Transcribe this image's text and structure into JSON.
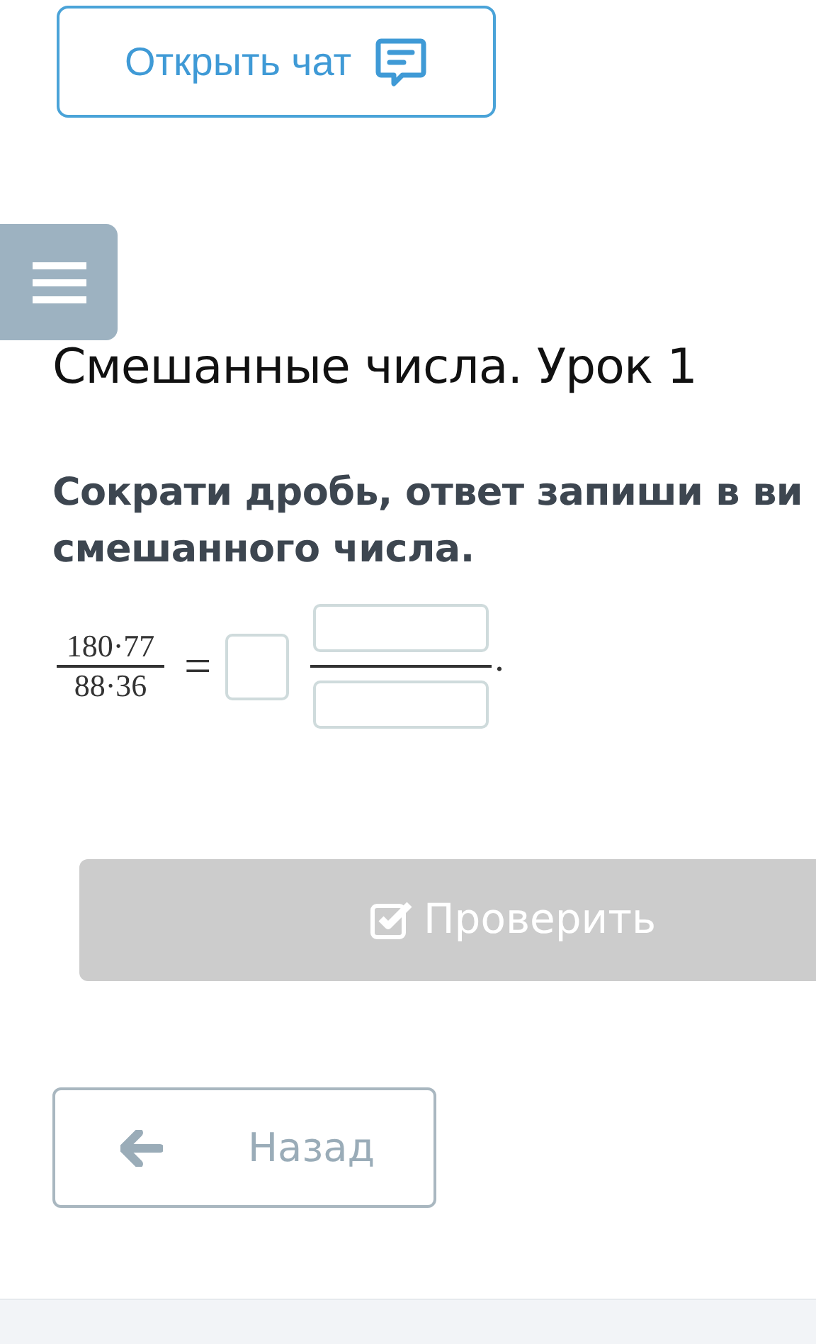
{
  "chat_button": {
    "label": "Открыть чат"
  },
  "lesson_title": "Смешанные числа. Урок 1",
  "task": {
    "lines": [
      "Сократи дробь, ответ запиши в ви",
      "смешанного числа."
    ],
    "fraction": {
      "numerator": "180·77",
      "denominator": "88·36"
    },
    "equals": "=",
    "period": "."
  },
  "check_button": {
    "label": "Проверить",
    "disabled": true
  },
  "back_button": {
    "label": "Назад"
  }
}
